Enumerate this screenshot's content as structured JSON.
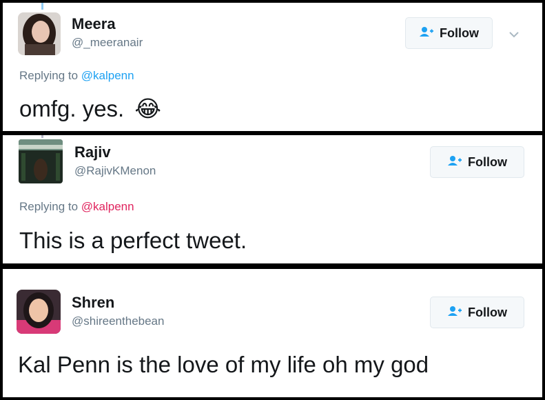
{
  "replies": [
    {
      "name": "Meera",
      "handle": "@_meeranair",
      "replying_prefix": "Replying to ",
      "replying_to": "@kalpenn",
      "text": "omfg. yes.",
      "emoji": "😂",
      "follow_label": "Follow"
    },
    {
      "name": "Rajiv",
      "handle": "@RajivKMenon",
      "replying_prefix": "Replying to ",
      "replying_to": "@kalpenn",
      "text": "This is a perfect tweet.",
      "follow_label": "Follow"
    },
    {
      "name": "Shren",
      "handle": "@shireenthebean",
      "text": "Kal Penn is the love of my life oh my god",
      "follow_label": "Follow"
    }
  ],
  "colors": {
    "mention_blue": "#1da1f2",
    "mention_pink": "#e0245e",
    "text": "#14171a",
    "muted": "#657786"
  },
  "icons": {
    "follow": "person-plus-icon",
    "more": "chevron-down-icon"
  }
}
